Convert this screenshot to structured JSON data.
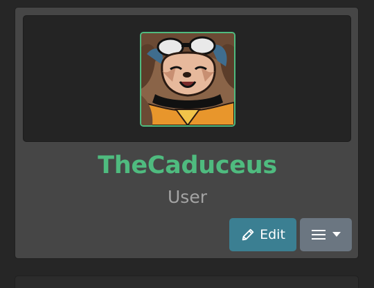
{
  "profile": {
    "username": "TheCaduceus",
    "role": "User",
    "avatar_alt": "User avatar"
  },
  "actions": {
    "edit_label": "Edit",
    "edit_icon": "pencil-icon",
    "menu_icon": "hamburger-menu-icon",
    "dropdown_icon": "caret-down-icon"
  },
  "colors": {
    "page_background": "#262626",
    "card_background": "#464646",
    "banner_background": "#242424",
    "accent_green": "#4fbb7f",
    "role_text": "#a4a4a4",
    "edit_button": "#3b7f92",
    "menu_button": "#6b7681"
  }
}
